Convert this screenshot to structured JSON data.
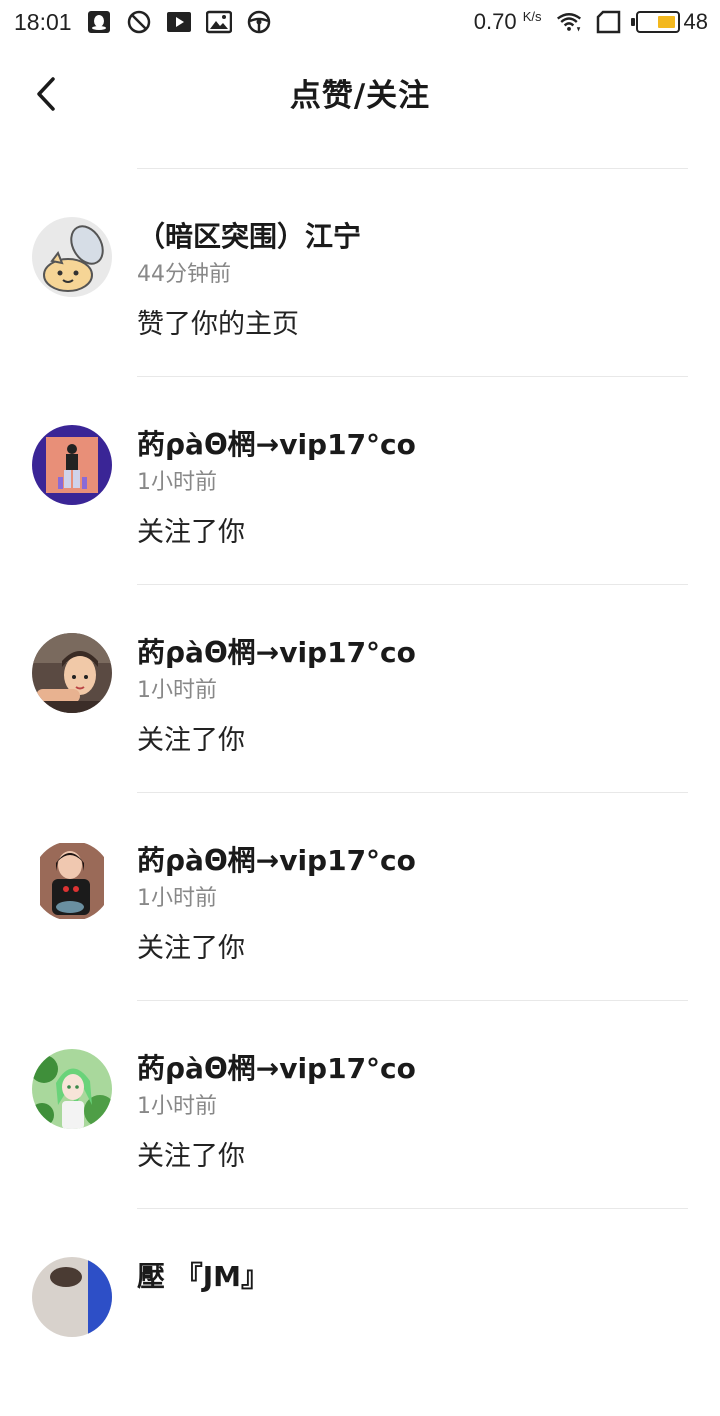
{
  "status_bar": {
    "time": "18:01",
    "net_speed": "0.70",
    "net_unit": "K/s",
    "battery": "48",
    "battery_level_percent": 48,
    "icons": [
      "qq-icon",
      "do-not-disturb-icon",
      "video-icon",
      "image-icon",
      "steering-wheel-icon",
      "wifi-icon",
      "sim-icon",
      "battery-icon"
    ]
  },
  "header": {
    "title": "点赞/关注",
    "back_icon": "back-chevron-icon"
  },
  "items": [
    {
      "name": "（暗区突围）江宁",
      "time": "44分钟前",
      "action": "赞了你的主页",
      "avatar": "cat-avatar"
    },
    {
      "name": "菂ρàΘ棢→vip17°co",
      "time": "1小时前",
      "action": "关注了你",
      "avatar": "purple-avatar"
    },
    {
      "name": "菂ρàΘ棢→vip17°co",
      "time": "1小时前",
      "action": "关注了你",
      "avatar": "girl-avatar"
    },
    {
      "name": "菂ρàΘ棢→vip17°co",
      "time": "1小时前",
      "action": "关注了你",
      "avatar": "photo-avatar"
    },
    {
      "name": "菂ρàΘ棢→vip17°co",
      "time": "1小时前",
      "action": "关注了你",
      "avatar": "green-avatar"
    },
    {
      "name": "壓 『JM』",
      "time": "",
      "action": "",
      "avatar": "partial-avatar"
    }
  ],
  "colors": {
    "battery_fill": "#f3b81e",
    "divider": "#e8e8e8",
    "time_text": "#888888"
  }
}
